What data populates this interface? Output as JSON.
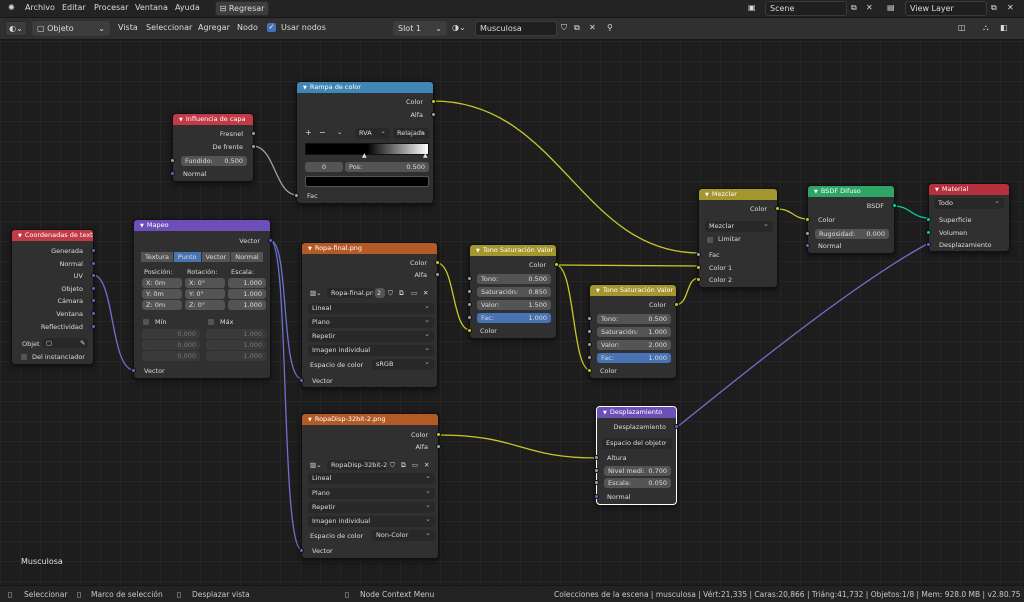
{
  "topbar": {
    "menus": [
      "Archivo",
      "Editar",
      "Procesar",
      "Ventana",
      "Ayuda"
    ],
    "back_button": "Regresar",
    "scene": "Scene",
    "view_layer": "View Layer"
  },
  "header": {
    "mode": "Objeto",
    "menus": [
      "Vista",
      "Seleccionar",
      "Agregar",
      "Nodo"
    ],
    "use_nodes_label": "Usar nodos",
    "slot": "Slot 1",
    "material": "Musculosa"
  },
  "nodes": {
    "texcoord": {
      "title": "Coordenadas de text...",
      "outputs": [
        "Generada",
        "Normal",
        "UV",
        "Objeto",
        "Cámara",
        "Ventana",
        "Reflectividad"
      ],
      "object_label": "Objet",
      "instancer_label": "Del instanciador"
    },
    "mapping": {
      "title": "Mapeo",
      "output": "Vector",
      "tabs": [
        "Textura",
        "Punto",
        "Vector",
        "Normal"
      ],
      "col_pos": "Posición:",
      "col_rot": "Rotación:",
      "col_scale": "Escala:",
      "pos": [
        "X:  0m",
        "Y:  0m",
        "Z:  0m"
      ],
      "rot": [
        "X:  0°",
        "Y:  0°",
        "Z:  0°"
      ],
      "scale": [
        "1.000",
        "1.000",
        "1.000"
      ],
      "min_label": "Mín",
      "max_label": "Máx",
      "min": [
        "0.000",
        "0.000",
        "0.000"
      ],
      "max": [
        "1.000",
        "1.000",
        "1.000"
      ],
      "input": "Vector"
    },
    "layerweight": {
      "title": "Influencia de capa",
      "outputs": [
        "Fresnel",
        "De frente"
      ],
      "blend_label": "Fundido:",
      "blend": "0.500",
      "input": "Normal"
    },
    "ramp": {
      "title": "Rampa de color",
      "outputs": [
        "Color",
        "Alfa"
      ],
      "mode": "RVA",
      "interp": "Relajada",
      "index": "0",
      "pos_label": "Pos:",
      "pos": "0.500",
      "input": "Fac"
    },
    "img1": {
      "title": "Ropa-final.png",
      "outputs": [
        "Color",
        "Alfa"
      ],
      "image": "Ropa-final.png",
      "users": "2",
      "interp": "Lineal",
      "proj": "Plano",
      "ext": "Repetir",
      "source": "Imagen individual",
      "cs_label": "Espacio de color",
      "cs": "sRGB",
      "input": "Vector"
    },
    "img2": {
      "title": "RopaDisp-32bit-2.png",
      "outputs": [
        "Color",
        "Alfa"
      ],
      "image": "RopaDisp-32bit-2...",
      "interp": "Lineal",
      "proj": "Plano",
      "ext": "Repetir",
      "source": "Imagen individual",
      "cs_label": "Espacio de color",
      "cs": "Non-Color",
      "input": "Vector"
    },
    "hsv1": {
      "title": "Tono Saturación Valor",
      "output": "Color",
      "fields": [
        [
          "Tono:",
          "0.500"
        ],
        [
          "Saturación:",
          "0.850"
        ],
        [
          "Valor:",
          "1.500"
        ],
        [
          "Fac:",
          "1.000"
        ]
      ],
      "input": "Color"
    },
    "hsv2": {
      "title": "Tono Saturación Valor",
      "output": "Color",
      "fields": [
        [
          "Tono:",
          "0.500"
        ],
        [
          "Saturación:",
          "1.000"
        ],
        [
          "Valor:",
          "2.000"
        ],
        [
          "Fac:",
          "1.000"
        ]
      ],
      "input": "Color"
    },
    "mix": {
      "title": "Mezclar",
      "output": "Color",
      "blend": "Mezclar",
      "clamp": "Limitar",
      "inputs": [
        "Fac",
        "Color 1",
        "Color 2"
      ]
    },
    "diffuse": {
      "title": "BSDF Difuso",
      "output": "BSDF",
      "inputs": [
        "Color"
      ],
      "rough_label": "Rugosidad:",
      "rough": "0.000",
      "normal": "Normal"
    },
    "material": {
      "title": "Material",
      "target": "Todo",
      "inputs": [
        "Superficie",
        "Volumen",
        "Desplazamiento"
      ]
    },
    "disp": {
      "title": "Desplazamiento",
      "output": "Desplazamiento",
      "space": "Espacio del objeto",
      "height": "Altura",
      "mid_label": "Nivel medi:",
      "mid": "0.700",
      "scale_label": "Escala:",
      "scale": "0.050",
      "normal": "Normal"
    }
  },
  "canvas_label": "Musculosa",
  "status": {
    "select": "Seleccionar",
    "box": "Marco de selección",
    "pan": "Desplazar vista",
    "context": "Node Context Menu",
    "stats": "Colecciones de la escena | musculosa | Vért:21,335 | Caras:20,866 | Triáng:41,732 | Objetos:1/8 | Mem: 928.0 MB | v2.80.75"
  },
  "colors": {
    "header_texcoord": "#c13a48",
    "header_mapping": "#6e4fb8",
    "header_image": "#b45a27",
    "header_hsv": "#a2962d",
    "header_ramp": "#3f86b5",
    "header_shader": "#2ea565",
    "header_output": "#b62f3d",
    "header_vector": "#6e4fb8"
  }
}
